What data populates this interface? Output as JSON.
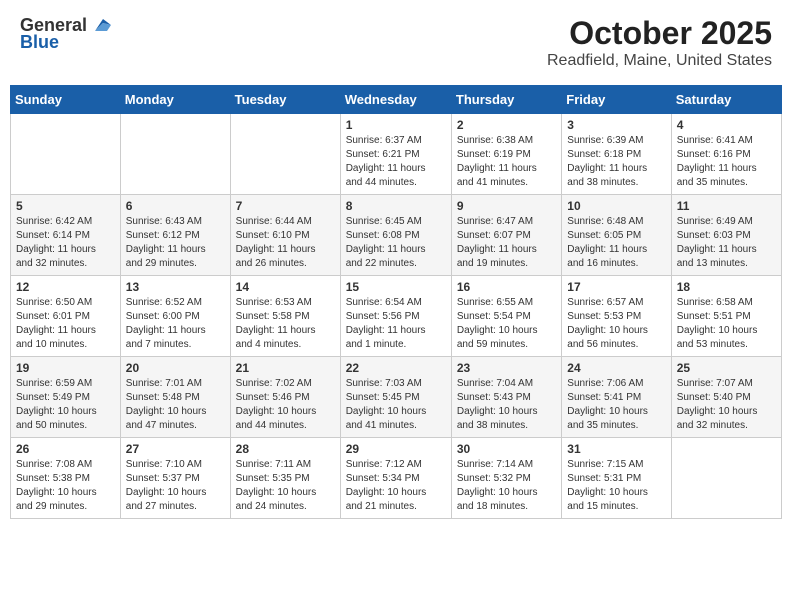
{
  "header": {
    "logo_general": "General",
    "logo_blue": "Blue",
    "title": "October 2025",
    "location": "Readfield, Maine, United States"
  },
  "weekdays": [
    "Sunday",
    "Monday",
    "Tuesday",
    "Wednesday",
    "Thursday",
    "Friday",
    "Saturday"
  ],
  "weeks": [
    [
      {
        "day": "",
        "info": ""
      },
      {
        "day": "",
        "info": ""
      },
      {
        "day": "",
        "info": ""
      },
      {
        "day": "1",
        "info": "Sunrise: 6:37 AM\nSunset: 6:21 PM\nDaylight: 11 hours\nand 44 minutes."
      },
      {
        "day": "2",
        "info": "Sunrise: 6:38 AM\nSunset: 6:19 PM\nDaylight: 11 hours\nand 41 minutes."
      },
      {
        "day": "3",
        "info": "Sunrise: 6:39 AM\nSunset: 6:18 PM\nDaylight: 11 hours\nand 38 minutes."
      },
      {
        "day": "4",
        "info": "Sunrise: 6:41 AM\nSunset: 6:16 PM\nDaylight: 11 hours\nand 35 minutes."
      }
    ],
    [
      {
        "day": "5",
        "info": "Sunrise: 6:42 AM\nSunset: 6:14 PM\nDaylight: 11 hours\nand 32 minutes."
      },
      {
        "day": "6",
        "info": "Sunrise: 6:43 AM\nSunset: 6:12 PM\nDaylight: 11 hours\nand 29 minutes."
      },
      {
        "day": "7",
        "info": "Sunrise: 6:44 AM\nSunset: 6:10 PM\nDaylight: 11 hours\nand 26 minutes."
      },
      {
        "day": "8",
        "info": "Sunrise: 6:45 AM\nSunset: 6:08 PM\nDaylight: 11 hours\nand 22 minutes."
      },
      {
        "day": "9",
        "info": "Sunrise: 6:47 AM\nSunset: 6:07 PM\nDaylight: 11 hours\nand 19 minutes."
      },
      {
        "day": "10",
        "info": "Sunrise: 6:48 AM\nSunset: 6:05 PM\nDaylight: 11 hours\nand 16 minutes."
      },
      {
        "day": "11",
        "info": "Sunrise: 6:49 AM\nSunset: 6:03 PM\nDaylight: 11 hours\nand 13 minutes."
      }
    ],
    [
      {
        "day": "12",
        "info": "Sunrise: 6:50 AM\nSunset: 6:01 PM\nDaylight: 11 hours\nand 10 minutes."
      },
      {
        "day": "13",
        "info": "Sunrise: 6:52 AM\nSunset: 6:00 PM\nDaylight: 11 hours\nand 7 minutes."
      },
      {
        "day": "14",
        "info": "Sunrise: 6:53 AM\nSunset: 5:58 PM\nDaylight: 11 hours\nand 4 minutes."
      },
      {
        "day": "15",
        "info": "Sunrise: 6:54 AM\nSunset: 5:56 PM\nDaylight: 11 hours\nand 1 minute."
      },
      {
        "day": "16",
        "info": "Sunrise: 6:55 AM\nSunset: 5:54 PM\nDaylight: 10 hours\nand 59 minutes."
      },
      {
        "day": "17",
        "info": "Sunrise: 6:57 AM\nSunset: 5:53 PM\nDaylight: 10 hours\nand 56 minutes."
      },
      {
        "day": "18",
        "info": "Sunrise: 6:58 AM\nSunset: 5:51 PM\nDaylight: 10 hours\nand 53 minutes."
      }
    ],
    [
      {
        "day": "19",
        "info": "Sunrise: 6:59 AM\nSunset: 5:49 PM\nDaylight: 10 hours\nand 50 minutes."
      },
      {
        "day": "20",
        "info": "Sunrise: 7:01 AM\nSunset: 5:48 PM\nDaylight: 10 hours\nand 47 minutes."
      },
      {
        "day": "21",
        "info": "Sunrise: 7:02 AM\nSunset: 5:46 PM\nDaylight: 10 hours\nand 44 minutes."
      },
      {
        "day": "22",
        "info": "Sunrise: 7:03 AM\nSunset: 5:45 PM\nDaylight: 10 hours\nand 41 minutes."
      },
      {
        "day": "23",
        "info": "Sunrise: 7:04 AM\nSunset: 5:43 PM\nDaylight: 10 hours\nand 38 minutes."
      },
      {
        "day": "24",
        "info": "Sunrise: 7:06 AM\nSunset: 5:41 PM\nDaylight: 10 hours\nand 35 minutes."
      },
      {
        "day": "25",
        "info": "Sunrise: 7:07 AM\nSunset: 5:40 PM\nDaylight: 10 hours\nand 32 minutes."
      }
    ],
    [
      {
        "day": "26",
        "info": "Sunrise: 7:08 AM\nSunset: 5:38 PM\nDaylight: 10 hours\nand 29 minutes."
      },
      {
        "day": "27",
        "info": "Sunrise: 7:10 AM\nSunset: 5:37 PM\nDaylight: 10 hours\nand 27 minutes."
      },
      {
        "day": "28",
        "info": "Sunrise: 7:11 AM\nSunset: 5:35 PM\nDaylight: 10 hours\nand 24 minutes."
      },
      {
        "day": "29",
        "info": "Sunrise: 7:12 AM\nSunset: 5:34 PM\nDaylight: 10 hours\nand 21 minutes."
      },
      {
        "day": "30",
        "info": "Sunrise: 7:14 AM\nSunset: 5:32 PM\nDaylight: 10 hours\nand 18 minutes."
      },
      {
        "day": "31",
        "info": "Sunrise: 7:15 AM\nSunset: 5:31 PM\nDaylight: 10 hours\nand 15 minutes."
      },
      {
        "day": "",
        "info": ""
      }
    ]
  ]
}
